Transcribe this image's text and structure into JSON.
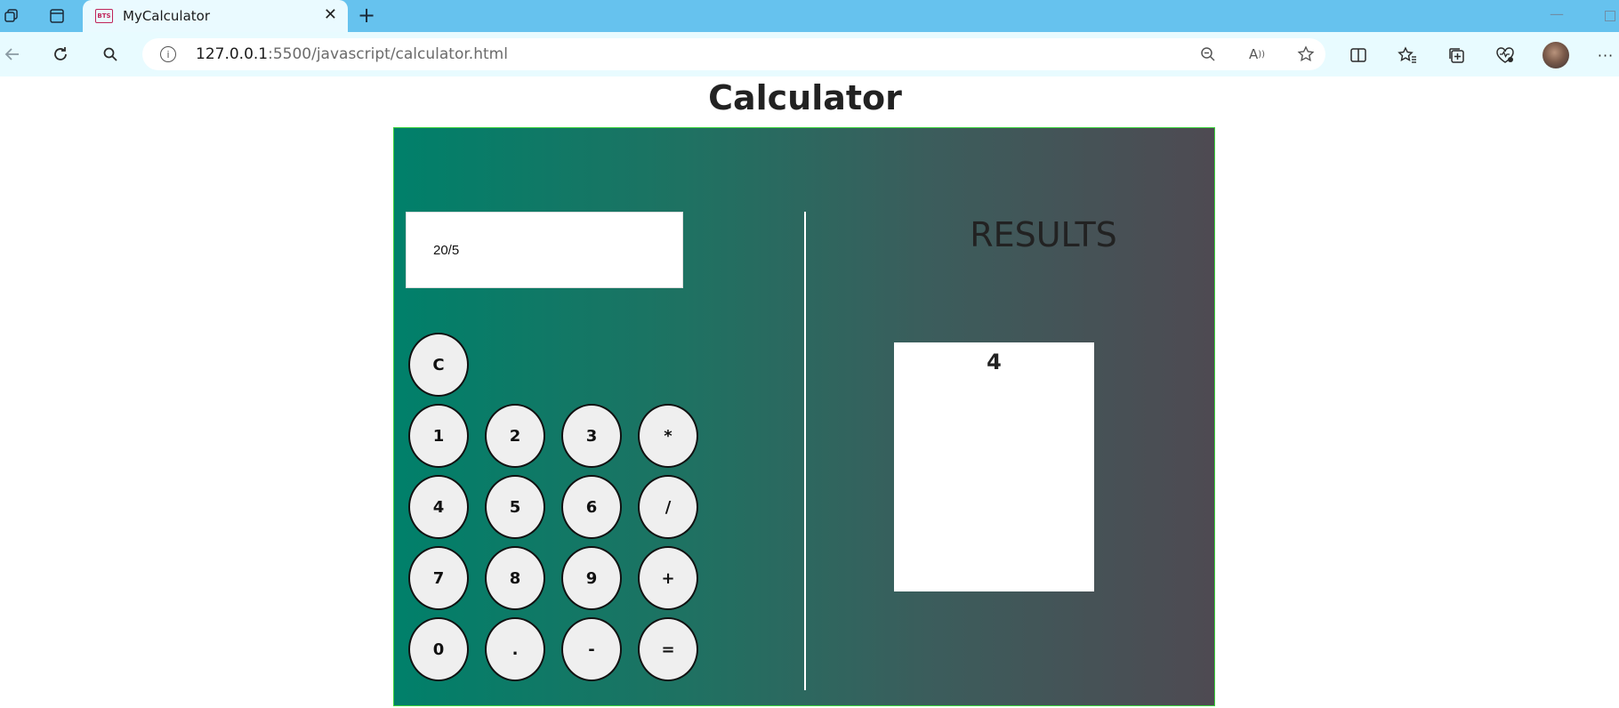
{
  "browser": {
    "tab": {
      "title": "MyCalculator",
      "favicon_text": "BTS"
    },
    "url": {
      "host": "127.0.0.1",
      "rest": ":5500/javascript/calculator.html"
    },
    "icons": {
      "workspaces": "workspaces-icon",
      "tab_actions": "tab-actions-icon",
      "close": "close-icon",
      "new_tab": "plus-icon",
      "back": "back-arrow-icon",
      "refresh": "refresh-icon",
      "search": "search-icon",
      "site_info": "info-icon",
      "zoom": "zoom-out-icon",
      "read_aloud": "read-aloud-icon",
      "favorite": "star-icon",
      "split_screen": "split-screen-icon",
      "favorites": "favorites-icon",
      "collections": "collections-icon",
      "performance": "heart-pulse-icon",
      "profile": "avatar",
      "menu": "more-icon"
    }
  },
  "page": {
    "title": "Calculator",
    "display_value": "20/5",
    "results_title": "RESULTS",
    "result_value": "4"
  },
  "keypad": {
    "clear": "C",
    "rows": [
      [
        "1",
        "2",
        "3",
        "*"
      ],
      [
        "4",
        "5",
        "6",
        "/"
      ],
      [
        "7",
        "8",
        "9",
        "+"
      ],
      [
        "0",
        ".",
        "-",
        "="
      ]
    ]
  },
  "colors": {
    "gradient_start": "#00806a",
    "gradient_end": "#4e4a52",
    "tabstrip": "#66c2ee",
    "toolbar": "#e8fbff",
    "border": "#3dd33d"
  }
}
